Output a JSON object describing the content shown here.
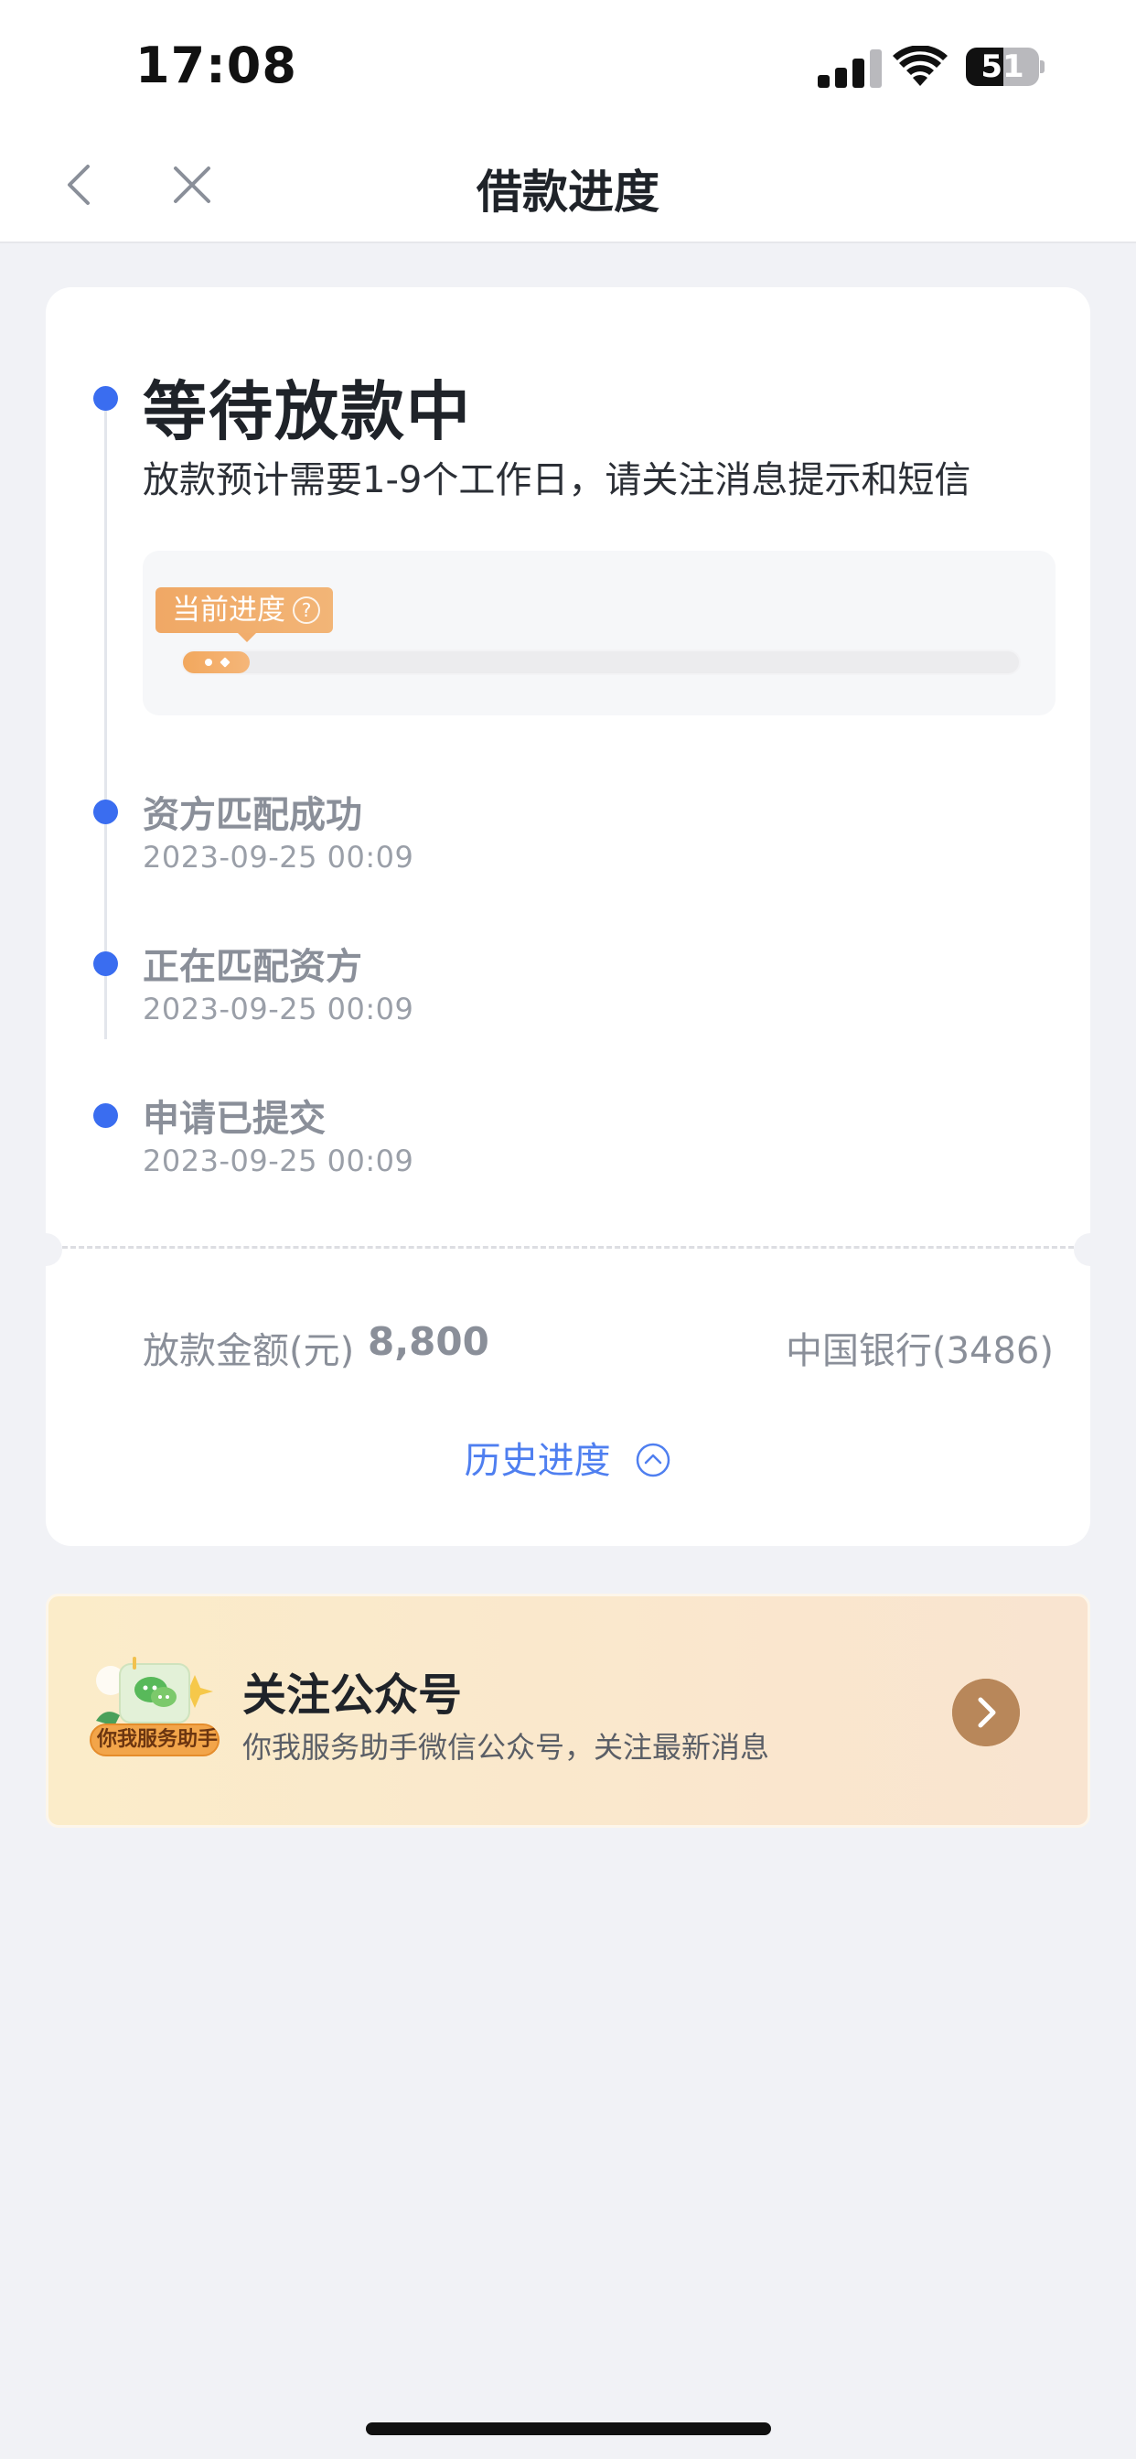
{
  "status_bar": {
    "time": "17:08",
    "battery_percent": "51",
    "battery_level": 0.51
  },
  "nav": {
    "title": "借款进度",
    "back_icon": "chevron-left-icon",
    "close_icon": "close-icon"
  },
  "progress_card": {
    "current_step": {
      "title": "等待放款中",
      "description": "放款预计需要1-9个工作日，请关注消息提示和短信"
    },
    "progress": {
      "tag_label": "当前进度",
      "tag_icon": "question-circle-icon",
      "level": 0.08
    },
    "steps": [
      {
        "title": "资方匹配成功",
        "time": "2023-09-25 00:09"
      },
      {
        "title": "正在匹配资方",
        "time": "2023-09-25 00:09"
      },
      {
        "title": "申请已提交",
        "time": "2023-09-25 00:09"
      }
    ],
    "amount_label": "放款金额(元)",
    "amount_value": "8,800",
    "bank": "中国银行(3486)",
    "history_label": "历史进度",
    "history_icon": "chevron-up-circle-icon"
  },
  "follow_card": {
    "badge_label": "你我服务助手",
    "title": "关注公众号",
    "description": "你我服务助手微信公众号，关注最新消息",
    "arrow_icon": "chevron-right-icon"
  },
  "colors": {
    "accent_blue": "#3a6df0",
    "link_blue": "#4f7ff0",
    "progress_orange": "#f2a85e",
    "follow_arrow": "#b8875a",
    "background": "#f1f2f6"
  }
}
